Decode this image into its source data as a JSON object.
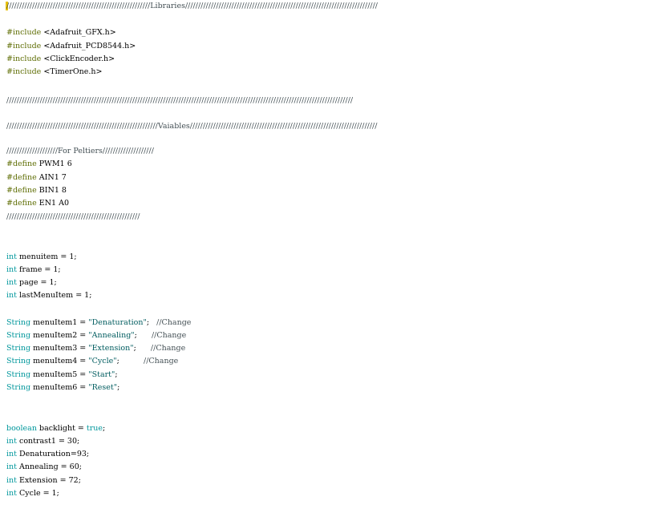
{
  "editor": {
    "lines": [
      {
        "id": "l01",
        "tokens": [
          {
            "kind": "comment",
            "text": "////////////////////////////////////////////////////////Libraries///////////////////////////////////////////////////////////////////////////"
          }
        ]
      },
      {
        "id": "l02",
        "tokens": [
          {
            "kind": "directive",
            "text": "#include"
          },
          {
            "kind": "plain",
            "text": " <Adafruit_GFX.h>"
          }
        ]
      },
      {
        "id": "l03",
        "tokens": [
          {
            "kind": "directive",
            "text": "#include"
          },
          {
            "kind": "plain",
            "text": " <Adafruit_PCD8544.h>"
          }
        ]
      },
      {
        "id": "l04",
        "tokens": [
          {
            "kind": "directive",
            "text": "#include"
          },
          {
            "kind": "plain",
            "text": " <ClickEncoder.h>"
          }
        ]
      },
      {
        "id": "l05",
        "tokens": [
          {
            "kind": "directive",
            "text": "#include"
          },
          {
            "kind": "plain",
            "text": " <TimerOne.h>"
          }
        ]
      },
      {
        "id": "l06",
        "tokens": [
          {
            "kind": "comment",
            "text": "///////////////////////////////////////////////////////////////////////////////////////////////////////////////////////////////////////"
          }
        ]
      },
      {
        "id": "l07",
        "tokens": [
          {
            "kind": "comment",
            "text": "///////////////////////////////////////////////////////////Vaiables/////////////////////////////////////////////////////////////////////////"
          }
        ]
      },
      {
        "id": "l08",
        "tokens": [
          {
            "kind": "comment",
            "text": "////////////////////For Peltiers////////////////////"
          }
        ]
      },
      {
        "id": "l09",
        "tokens": [
          {
            "kind": "directive",
            "text": "#define"
          },
          {
            "kind": "plain",
            "text": " PWM1 6"
          }
        ]
      },
      {
        "id": "l10",
        "tokens": [
          {
            "kind": "directive",
            "text": "#define"
          },
          {
            "kind": "plain",
            "text": " AIN1 7"
          }
        ]
      },
      {
        "id": "l11",
        "tokens": [
          {
            "kind": "directive",
            "text": "#define"
          },
          {
            "kind": "plain",
            "text": " BIN1 8"
          }
        ]
      },
      {
        "id": "l12",
        "tokens": [
          {
            "kind": "directive",
            "text": "#define"
          },
          {
            "kind": "plain",
            "text": " EN1 A0"
          }
        ]
      },
      {
        "id": "l13",
        "tokens": [
          {
            "kind": "comment",
            "text": "////////////////////////////////////////////////////"
          }
        ]
      },
      {
        "id": "l14",
        "tokens": [
          {
            "kind": "type",
            "text": "int"
          },
          {
            "kind": "plain",
            "text": " menuitem = 1;"
          }
        ]
      },
      {
        "id": "l15",
        "tokens": [
          {
            "kind": "type",
            "text": "int"
          },
          {
            "kind": "plain",
            "text": " frame = 1;"
          }
        ]
      },
      {
        "id": "l16",
        "tokens": [
          {
            "kind": "type",
            "text": "int"
          },
          {
            "kind": "plain",
            "text": " page = 1;"
          }
        ]
      },
      {
        "id": "l17",
        "tokens": [
          {
            "kind": "type",
            "text": "int"
          },
          {
            "kind": "plain",
            "text": " lastMenuItem = 1;"
          }
        ]
      },
      {
        "id": "l18",
        "tokens": [
          {
            "kind": "type",
            "text": "String"
          },
          {
            "kind": "plain",
            "text": " menuItem1 = "
          },
          {
            "kind": "string",
            "text": "\"Denaturation\""
          },
          {
            "kind": "plain",
            "text": ";"
          },
          {
            "kind": "gap",
            "text": "   "
          },
          {
            "kind": "comment",
            "text": "//Change"
          }
        ]
      },
      {
        "id": "l19",
        "tokens": [
          {
            "kind": "type",
            "text": "String"
          },
          {
            "kind": "plain",
            "text": " menuItem2 = "
          },
          {
            "kind": "string",
            "text": "\"Annealing\""
          },
          {
            "kind": "plain",
            "text": ";"
          },
          {
            "kind": "gap",
            "text": "      "
          },
          {
            "kind": "comment",
            "text": "//Change"
          }
        ]
      },
      {
        "id": "l20",
        "tokens": [
          {
            "kind": "type",
            "text": "String"
          },
          {
            "kind": "plain",
            "text": " menuItem3 = "
          },
          {
            "kind": "string",
            "text": "\"Extension\""
          },
          {
            "kind": "plain",
            "text": ";"
          },
          {
            "kind": "gap",
            "text": "      "
          },
          {
            "kind": "comment",
            "text": "//Change"
          }
        ]
      },
      {
        "id": "l21",
        "tokens": [
          {
            "kind": "type",
            "text": "String"
          },
          {
            "kind": "plain",
            "text": " menuItem4 = "
          },
          {
            "kind": "string",
            "text": "\"Cycle\""
          },
          {
            "kind": "plain",
            "text": ";"
          },
          {
            "kind": "gap",
            "text": "          "
          },
          {
            "kind": "comment",
            "text": "//Change"
          }
        ]
      },
      {
        "id": "l22",
        "tokens": [
          {
            "kind": "type",
            "text": "String"
          },
          {
            "kind": "plain",
            "text": " menuItem5 = "
          },
          {
            "kind": "string",
            "text": "\"Start\""
          },
          {
            "kind": "plain",
            "text": ";"
          }
        ]
      },
      {
        "id": "l23",
        "tokens": [
          {
            "kind": "type",
            "text": "String"
          },
          {
            "kind": "plain",
            "text": " menuItem6 = "
          },
          {
            "kind": "string",
            "text": "\"Reset\""
          },
          {
            "kind": "plain",
            "text": ";"
          }
        ]
      },
      {
        "id": "l24",
        "tokens": [
          {
            "kind": "type",
            "text": "boolean"
          },
          {
            "kind": "plain",
            "text": " backlight = "
          },
          {
            "kind": "literal",
            "text": "true"
          },
          {
            "kind": "plain",
            "text": ";"
          }
        ]
      },
      {
        "id": "l25",
        "tokens": [
          {
            "kind": "type",
            "text": "int"
          },
          {
            "kind": "plain",
            "text": " contrast1 = 30;"
          }
        ]
      },
      {
        "id": "l26",
        "tokens": [
          {
            "kind": "type",
            "text": "int"
          },
          {
            "kind": "plain",
            "text": " Denaturation=93;"
          }
        ]
      },
      {
        "id": "l27",
        "tokens": [
          {
            "kind": "type",
            "text": "int"
          },
          {
            "kind": "plain",
            "text": " Annealing = 60;"
          }
        ]
      },
      {
        "id": "l28",
        "tokens": [
          {
            "kind": "type",
            "text": "int"
          },
          {
            "kind": "plain",
            "text": " Extension = 72;"
          }
        ]
      },
      {
        "id": "l29",
        "tokens": [
          {
            "kind": "type",
            "text": "int"
          },
          {
            "kind": "plain",
            "text": " Cycle = 1;"
          }
        ]
      }
    ]
  }
}
